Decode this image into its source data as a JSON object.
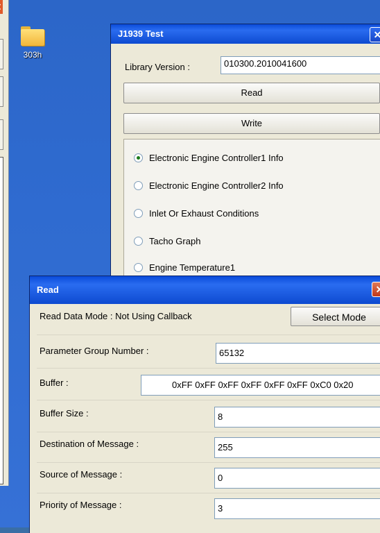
{
  "desktop": {
    "icon_label": "303h",
    "left_window_close_glyph": "✕"
  },
  "j1939_window": {
    "title": "J1939 Test",
    "close_glyph": "✕",
    "library_version_label": "Library Version :",
    "library_version_value": "010300.2010041600",
    "read_button": "Read",
    "write_button": "Write",
    "options": [
      {
        "label": "Electronic Engine Controller1 Info",
        "selected": true
      },
      {
        "label": "Electronic Engine Controller2 Info",
        "selected": false
      },
      {
        "label": "Inlet Or Exhaust Conditions",
        "selected": false
      },
      {
        "label": "Tacho Graph",
        "selected": false
      },
      {
        "label": "Engine Temperature1",
        "selected": false
      }
    ]
  },
  "read_window": {
    "title": "Read",
    "close_glyph": "✕",
    "mode_text": "Read Data Mode : Not Using Callback",
    "select_mode_button": "Select Mode",
    "fields": {
      "pgn_label": "Parameter Group Number :",
      "pgn_value": "65132",
      "buffer_label": "Buffer :",
      "buffer_value": "0xFF 0xFF 0xFF 0xFF 0xFF 0xFF 0xC0 0x20",
      "buffer_size_label": "Buffer Size :",
      "buffer_size_value": "8",
      "dest_label": "Destination of Message :",
      "dest_value": "255",
      "source_label": "Source of Message :",
      "source_value": "0",
      "priority_label": "Priority of Message :",
      "priority_value": "3"
    }
  },
  "colors": {
    "title_bar": "#0d4ad0",
    "window_bg": "#ece9d8",
    "desktop": "#2f6bd0"
  }
}
